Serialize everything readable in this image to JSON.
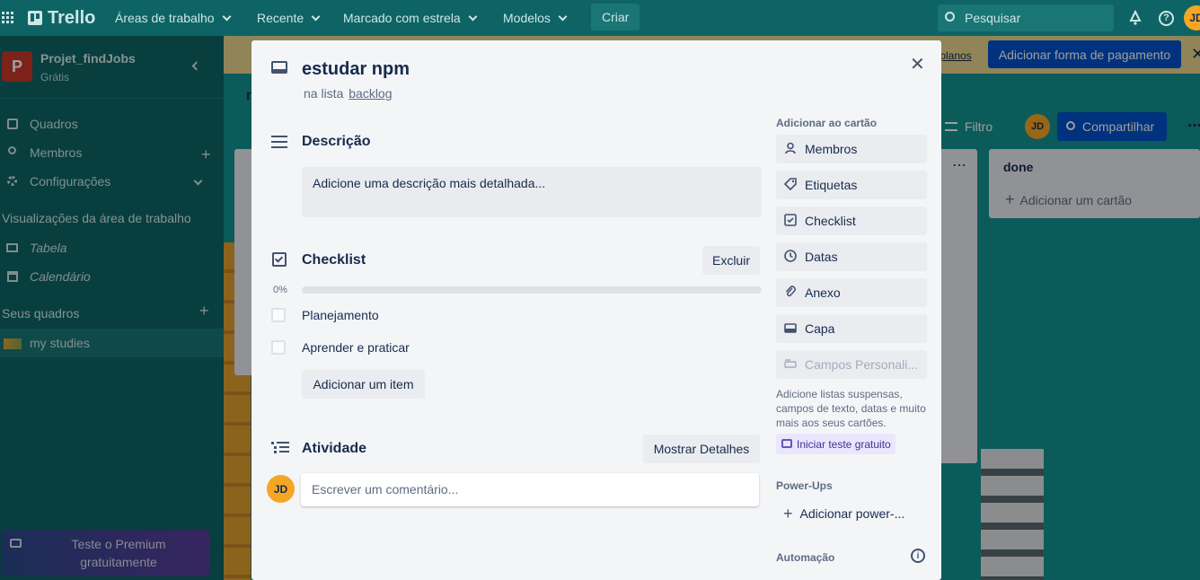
{
  "topbar": {
    "logo": "Trello",
    "menus": [
      "Áreas de trabalho",
      "Recente",
      "Marcado com estrela",
      "Modelos"
    ],
    "create": "Criar",
    "search_placeholder": "Pesquisar",
    "avatar": "JD"
  },
  "banner": {
    "link": "r planos",
    "button": "Adicionar forma de pagamento"
  },
  "board": {
    "title_fragment": "n",
    "filter": "Filtro",
    "share": "Compartilhar",
    "avatar": "JD",
    "done_list": {
      "title": "done",
      "add_card": "Adicionar um cartão"
    }
  },
  "sidebar": {
    "workspace_letter": "P",
    "workspace_name": "Projet_findJobs",
    "plan": "Grátis",
    "items": [
      "Quadros",
      "Membros",
      "Configurações"
    ],
    "views_header": "Visualizações da área de trabalho",
    "views": [
      "Tabela",
      "Calendário"
    ],
    "boards_header": "Seus quadros",
    "boards": [
      "my studies"
    ],
    "premium": "Teste o Premium gratuitamente"
  },
  "card": {
    "title": "estudar npm",
    "in_list_prefix": "na lista",
    "list_name": "backlog",
    "description": {
      "heading": "Descrição",
      "placeholder": "Adicione uma descrição mais detalhada..."
    },
    "checklist": {
      "heading": "Checklist",
      "delete": "Excluir",
      "progress_label": "0%",
      "progress": 0,
      "items": [
        "Planejamento",
        "Aprender e praticar"
      ],
      "add_item": "Adicionar um item"
    },
    "activity": {
      "heading": "Atividade",
      "show_details": "Mostrar Detalhes",
      "avatar": "JD",
      "comment_placeholder": "Escrever um comentário..."
    }
  },
  "card_sidebar": {
    "add_header": "Adicionar ao cartão",
    "buttons": [
      "Membros",
      "Etiquetas",
      "Checklist",
      "Datas",
      "Anexo",
      "Capa",
      "Campos Personali..."
    ],
    "custom_fields_note": "Adicione listas suspensas, campos de texto, datas e muito mais aos seus cartões.",
    "trial": "Iniciar teste gratuito",
    "powerups_header": "Power-Ups",
    "add_powerup": "Adicionar power-...",
    "automation_header": "Automação"
  },
  "colors": {
    "accent": "#0079bf",
    "trial_bg": "#eae6ff",
    "avatar": "#f5a623"
  }
}
